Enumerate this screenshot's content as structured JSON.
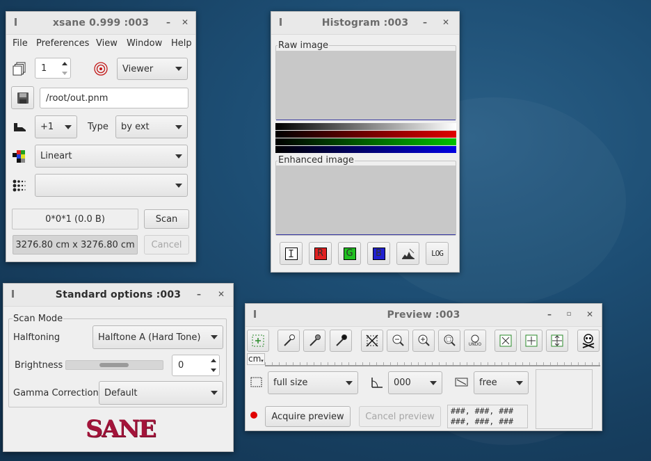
{
  "xsane": {
    "title": "xsane 0.999 :003",
    "menu": [
      "File",
      "Preferences",
      "View",
      "Window",
      "Help"
    ],
    "copies_value": "1",
    "viewer_label": "Viewer",
    "filename": "/root/out.pnm",
    "step_value": "+1",
    "type_label": "Type",
    "type_value": "by ext",
    "mode_value": "Lineart",
    "halftone_combo_value": "",
    "image_info": "0*0*1 (0.0 B)",
    "scan_label": "Scan",
    "size_info": "3276.80 cm x 3276.80 cm",
    "cancel_label": "Cancel"
  },
  "histogram": {
    "title": "Histogram :003",
    "raw_label": "Raw image",
    "enhanced_label": "Enhanced image",
    "buttons": [
      "I",
      "R",
      "G",
      "B",
      "",
      "LOG"
    ],
    "colors": {
      "red": "#e00000",
      "green": "#00c000",
      "blue": "#0000e0",
      "plot_bg": "#c8c8c8"
    }
  },
  "standard": {
    "title": "Standard options :003",
    "scan_mode_label": "Scan Mode",
    "halftoning_label": "Halftoning",
    "halftoning_value": "Halftone A (Hard Tone)",
    "brightness_label": "Brightness",
    "brightness_value": "0",
    "gamma_label": "Gamma Correction",
    "gamma_value": "Default",
    "logo_text": "SANE"
  },
  "preview": {
    "title": "Preview :003",
    "unit": "cm",
    "size_value": "full size",
    "rotation_value": "000",
    "aspect_value": "free",
    "acquire_label": "Acquire preview",
    "cancel_label": "Cancel preview",
    "coords_line1": "###, ###, ###",
    "coords_line2": "###, ###, ###",
    "undo_label": "UNDO"
  }
}
